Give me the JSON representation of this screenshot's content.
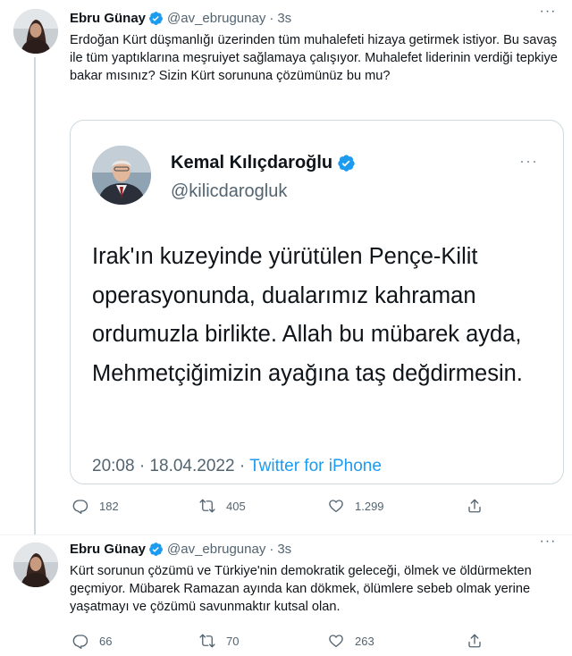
{
  "tweets": [
    {
      "author_name": "Ebru Günay",
      "handle": "@av_ebrugunay",
      "separator": "·",
      "time": "3s",
      "more_icon": "more-horizontal-icon",
      "text": "Erdoğan Kürt düşmanlığı üzerinden tüm muhalefeti hizaya getirmek istiyor. Bu savaş ile tüm yaptıklarına meşruiyet sağlamaya çalışıyor. Muhalefet liderinin verdiği tepkiye bakar mısınız? Sizin Kürt sorununa çözümünüz bu mu?",
      "quote": {
        "author_name": "Kemal Kılıçdaroğlu",
        "handle": "@kilicdarogluk",
        "text": "Irak'ın kuzeyinde yürütülen Pençe-Kilit operasyonunda, dualarımız kahraman ordumuzla birlikte. Allah bu mübarek ayda, Mehmetçiğimizin ayağına taş değdirmesin.",
        "timestamp": "20:08 · 18.04.2022",
        "separator": "·",
        "source": "Twitter for iPhone"
      },
      "stats": {
        "replies": "182",
        "retweets": "405",
        "likes": "1.299"
      }
    },
    {
      "author_name": "Ebru Günay",
      "handle": "@av_ebrugunay",
      "separator": "·",
      "time": "3s",
      "more_icon": "more-horizontal-icon",
      "text": "Kürt sorunun çözümü ve Türkiye'nin demokratik geleceği, ölmek ve öldürmekten geçmiyor. Mübarek Ramazan ayında kan dökmek, ölümlere sebeb olmak yerine yaşatmayı ve çözümü savunmaktır kutsal olan.",
      "stats": {
        "replies": "66",
        "retweets": "70",
        "likes": "263"
      }
    }
  ],
  "icons": {
    "reply": "reply-icon",
    "retweet": "retweet-icon",
    "like": "heart-icon",
    "share": "share-icon",
    "verified": "verified-badge-icon"
  },
  "colors": {
    "accent": "#1d9bf0",
    "text": "#0f1419",
    "secondary": "#536471",
    "border": "#cfd9de"
  }
}
